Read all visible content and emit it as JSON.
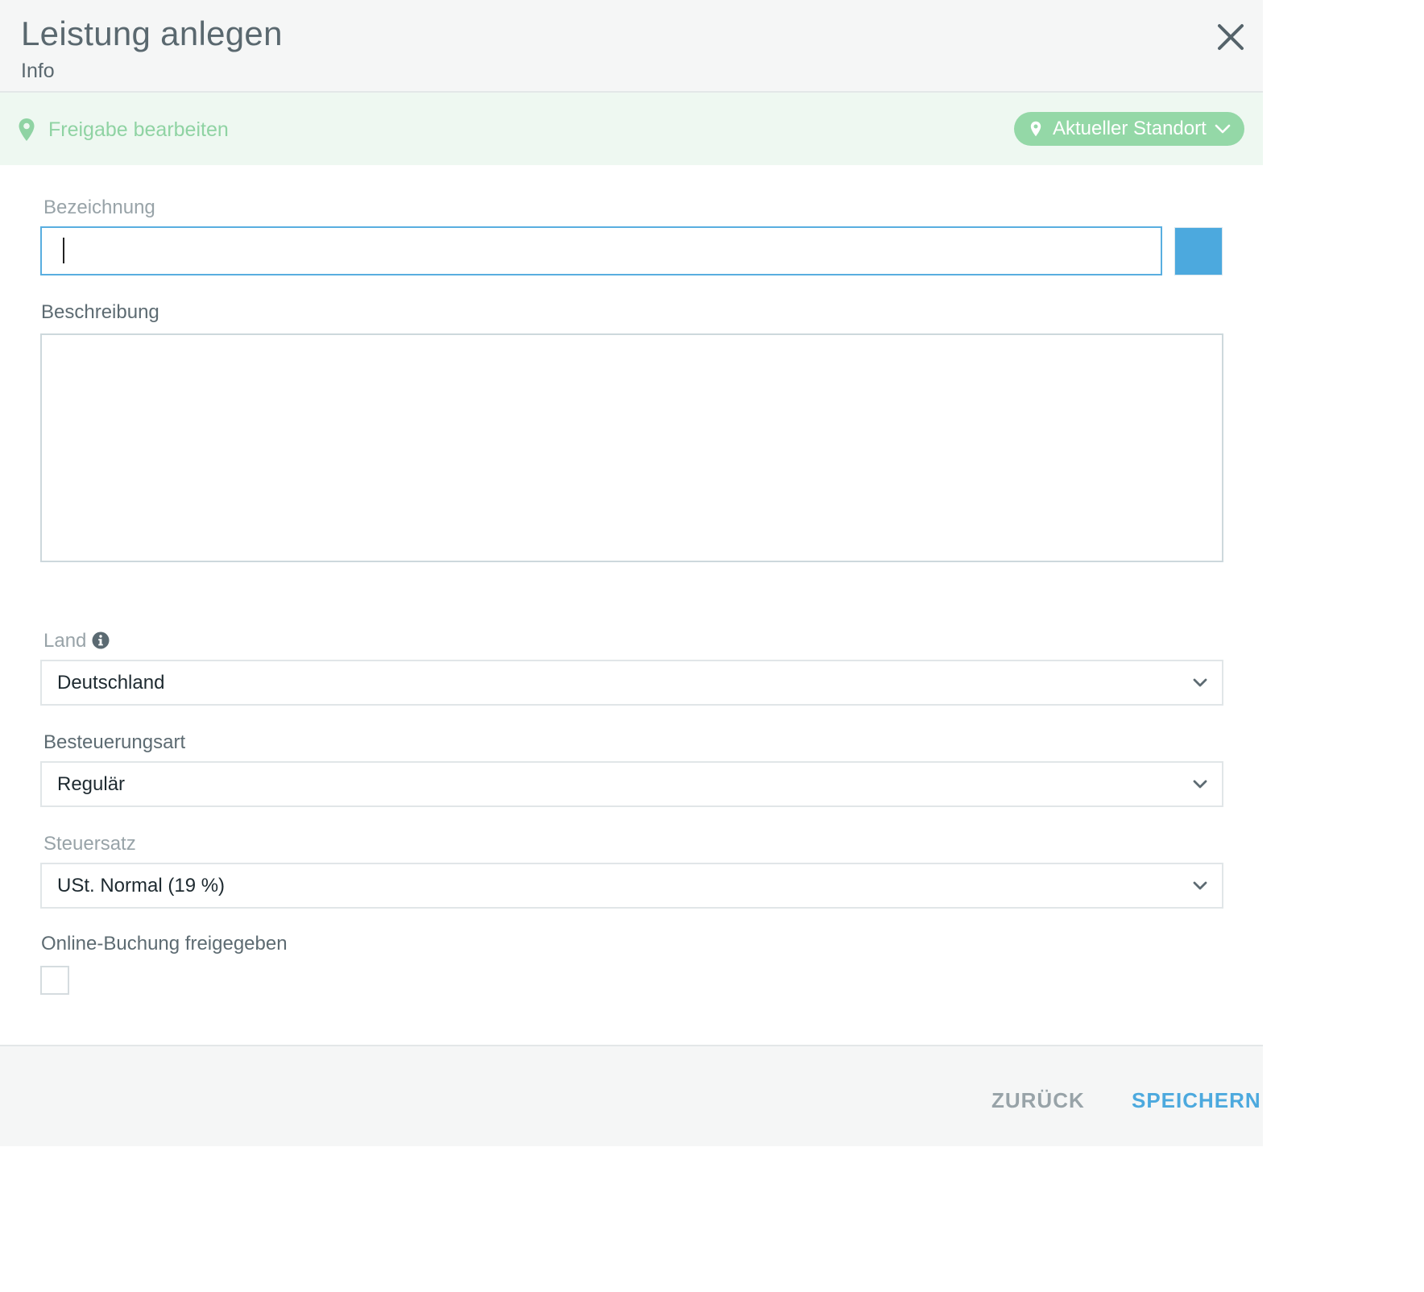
{
  "header": {
    "title": "Leistung anlegen",
    "subtitle": "Info",
    "close_icon": "close-icon"
  },
  "share_bar": {
    "link_label": "Freigabe bearbeiten",
    "link_icon": "map-pin-icon",
    "location_label": "Aktueller Standort",
    "accent_color": "#94d8a7"
  },
  "form": {
    "name": {
      "label": "Bezeichnung",
      "value": "",
      "color": "#4ca9de"
    },
    "description": {
      "label": "Beschreibung",
      "value": ""
    },
    "country": {
      "label": "Land",
      "value": "Deutschland",
      "info_icon": "info-icon"
    },
    "taxation": {
      "label": "Besteuerungsart",
      "value": "Regulär"
    },
    "tax_rate": {
      "label": "Steuersatz",
      "value": "USt. Normal (19 %)"
    },
    "online_booking": {
      "label": "Online-Buchung freigegeben",
      "checked": false
    }
  },
  "footer": {
    "back_label": "ZURÜCK",
    "save_label": "SPEICHERN",
    "save_color": "#4ca9de"
  }
}
